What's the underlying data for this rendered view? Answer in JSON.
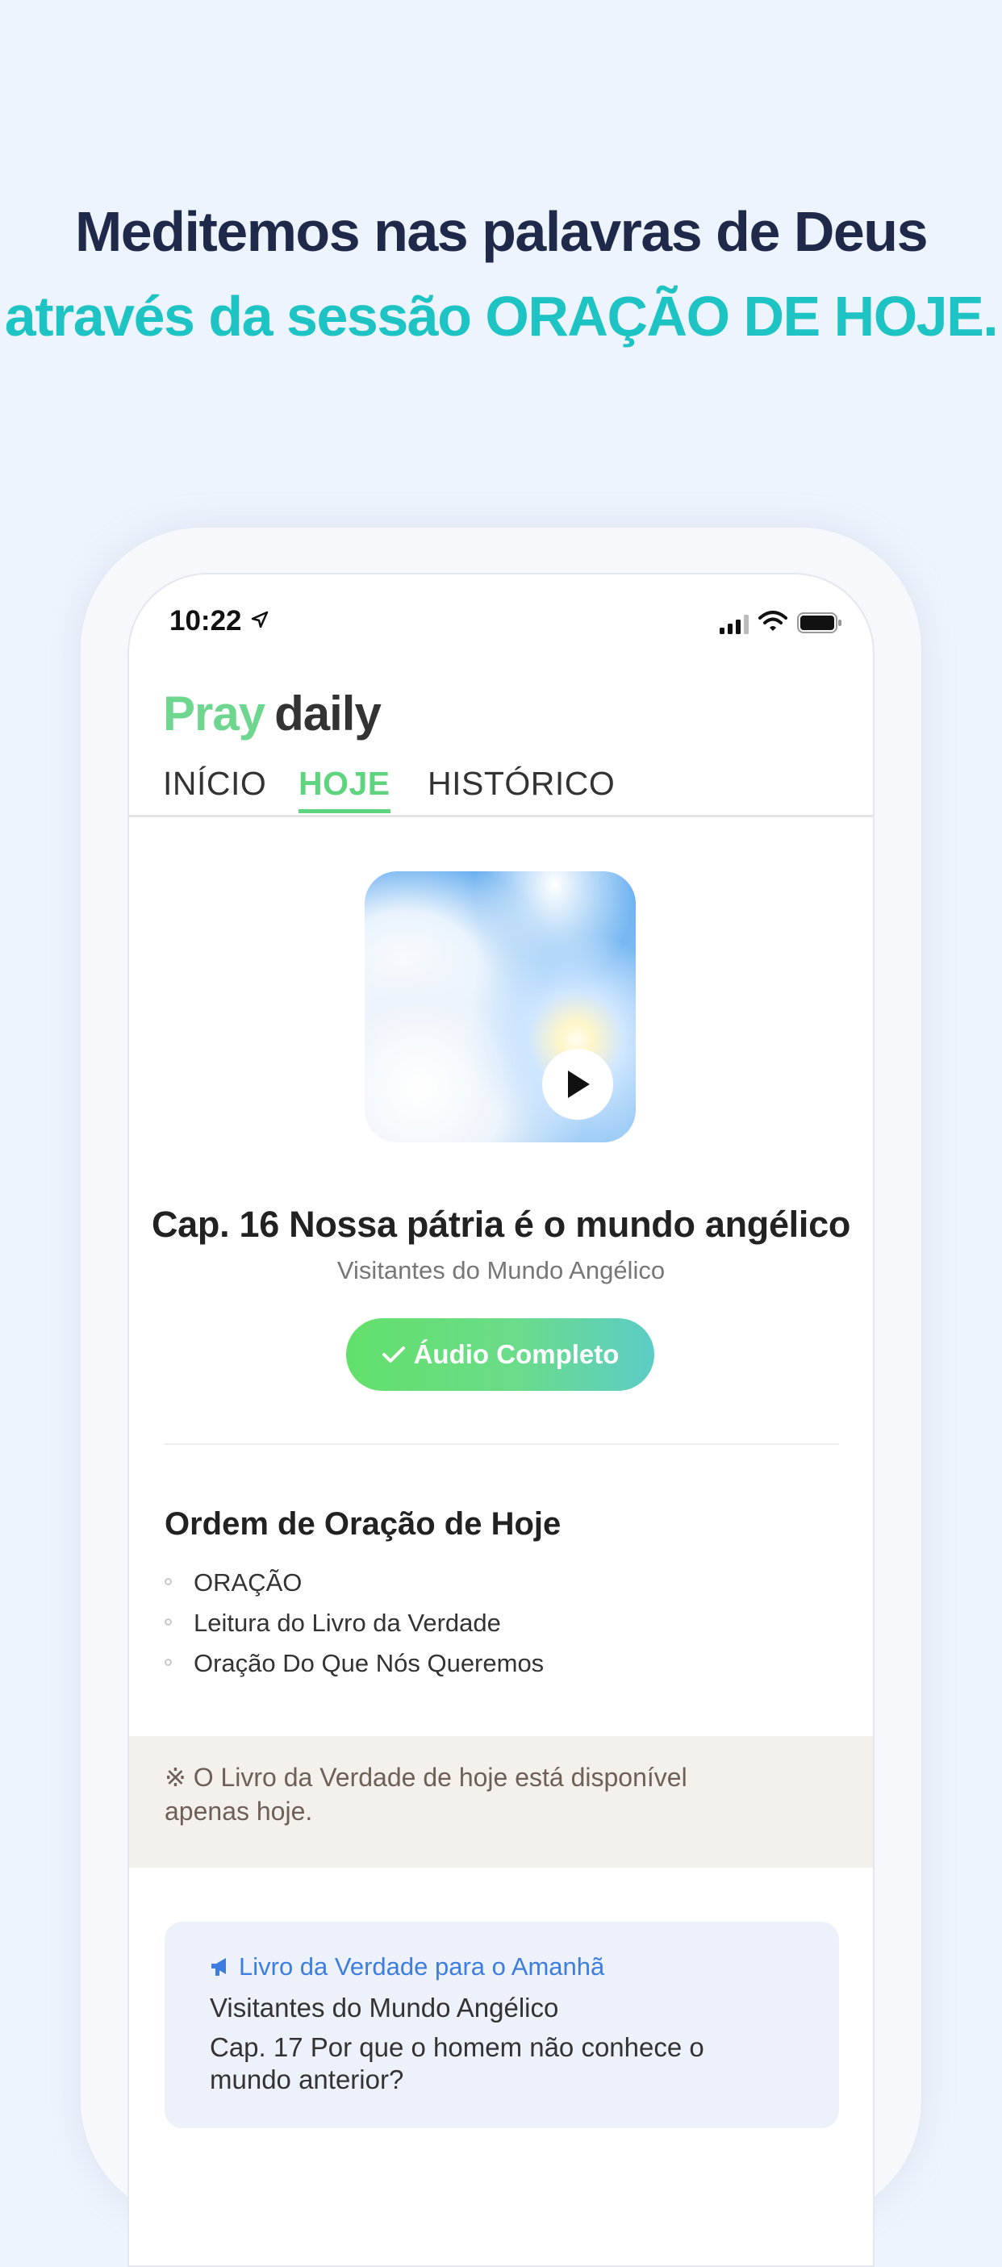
{
  "headline": {
    "line1": "Meditemos nas palavras de Deus",
    "line2": "através da sessão ORAÇÃO DE HOJE."
  },
  "status_bar": {
    "time": "10:22",
    "icons": [
      "location-arrow-icon",
      "signal-icon",
      "wifi-icon",
      "battery-icon"
    ]
  },
  "app": {
    "logo_pray": "Pray",
    "logo_daily": "daily",
    "tabs": [
      {
        "label": "INÍCIO",
        "active": false
      },
      {
        "label": "HOJE",
        "active": true
      },
      {
        "label": "HISTÓRICO",
        "active": false
      }
    ]
  },
  "today": {
    "chapter_title": "Cap. 16 Nossa pátria é o mundo angélico",
    "book_title": "Visitantes do Mundo Angélico",
    "audio_button": "Áudio Completo",
    "order_title": "Ordem de Oração de Hoje",
    "order_items": [
      "ORAÇÃO",
      "Leitura do Livro da Verdade",
      "Oração Do Que Nós Queremos"
    ],
    "notice": "※ O Livro da Verdade de hoje está disponível apenas hoje."
  },
  "tomorrow": {
    "heading": "Livro da Verdade para o Amanhã",
    "book": "Visitantes do Mundo Angélico",
    "chapter": "Cap. 17 Por que o homem não conhece o mundo anterior?"
  },
  "colors": {
    "accent_green": "#5fd47e",
    "headline_dark": "#1f2a4a",
    "headline_teal": "#1ec3c4",
    "link_blue": "#3d7de0"
  }
}
